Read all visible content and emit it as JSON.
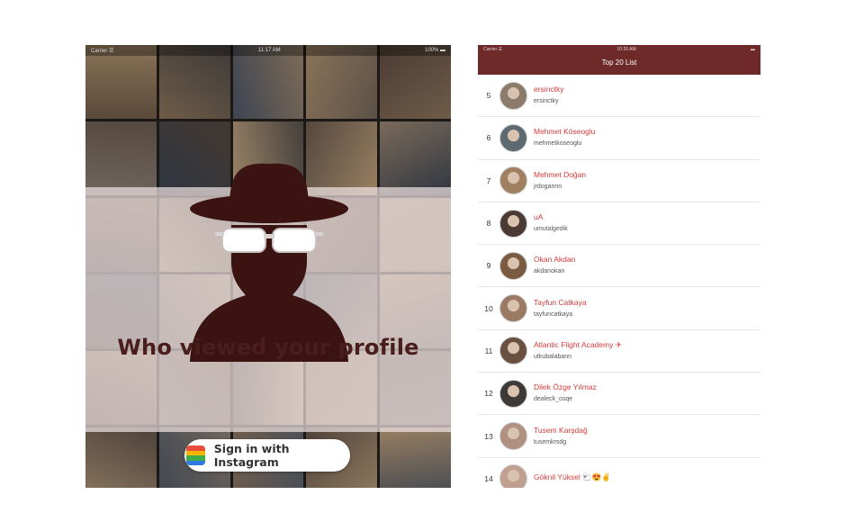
{
  "left_screen": {
    "status": {
      "carrier": "Carrier ☰",
      "time": "11:17 AM",
      "battery": "100% ▬"
    },
    "headline": "Who viewed your profile",
    "signin_label": "Sign in with Instagram",
    "icons": {
      "hero": "spy-silhouette-icon",
      "signin": "instagram-icon"
    },
    "colors": {
      "accent": "#4a1e1c",
      "band": "#eee2e2"
    }
  },
  "right_screen": {
    "status": {
      "carrier": "Carrier ☰",
      "time": "10:26 AM",
      "battery": "▬"
    },
    "title": "Top 20 List",
    "colors": {
      "header": "#6d2a28",
      "name": "#d63b3b"
    },
    "rows": [
      {
        "rank": "5",
        "name": "ersinctky",
        "username": "ersinctky"
      },
      {
        "rank": "6",
        "name": "Mehmet Köseoglu",
        "username": "mehmetkoseoglu"
      },
      {
        "rank": "7",
        "name": "Mehmet Doğan",
        "username": "jrdogannn"
      },
      {
        "rank": "8",
        "name": "uA",
        "username": "umutalgedik"
      },
      {
        "rank": "9",
        "name": "Okan Akdan",
        "username": "akdanokan"
      },
      {
        "rank": "10",
        "name": "Tayfun Catkaya",
        "username": "tayfuncatkaya"
      },
      {
        "rank": "11",
        "name": "Atlantic Flight Academy ✈",
        "username": "utkubalabann"
      },
      {
        "rank": "12",
        "name": "Dilek Özge Yılmaz",
        "username": "dealeck_osqe"
      },
      {
        "rank": "13",
        "name": "Tusem Karşdağ",
        "username": "tusemkrsdg"
      },
      {
        "rank": "14",
        "name": "Göknil Yüksel 🐑😍✌",
        "username": ""
      }
    ]
  }
}
